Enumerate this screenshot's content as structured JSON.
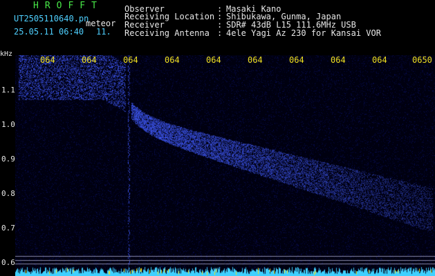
{
  "header": {
    "brand": "HROFFT",
    "filename": "UT2505110640.pn",
    "meteor_type": "meteor",
    "timestamp": "25.05.11 06:40",
    "count": "11.",
    "meta": [
      {
        "label": "Observer",
        "value": "Masaki Kano"
      },
      {
        "label": "Receiving Location",
        "value": "Shibukawa, Gunma, Japan"
      },
      {
        "label": "Receiver",
        "value": "SDR# 43dB L15 111.6MHz USB"
      },
      {
        "label": "Receiving Antenna",
        "value": "4ele Yagi Az 230 for Kansai VOR"
      }
    ],
    "colon": ":"
  },
  "axes": {
    "y_unit": "kHz",
    "y_labels": [
      "1.1",
      "1.0",
      "0.9",
      "0.8",
      "0.7",
      "0.6"
    ],
    "x_labels": [
      "064",
      "064",
      "064",
      "064",
      "064",
      "064",
      "064",
      "064",
      "064",
      "0650"
    ]
  },
  "colors": {
    "background": "#000000",
    "signal": "#2a3cff",
    "noise_floor": "#40e0ff",
    "x_labels": "#f0e020",
    "header_text": "#e8e8e8",
    "brand": "#48e848"
  }
}
